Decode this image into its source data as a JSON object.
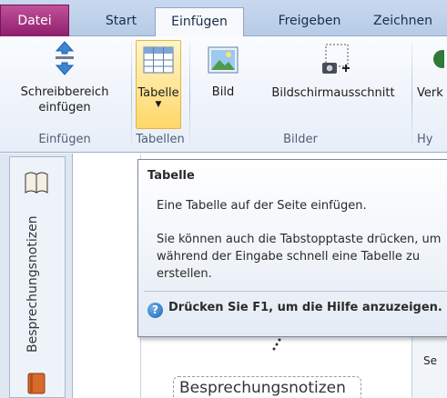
{
  "tabs": [
    {
      "label": "Datei",
      "kind": "file"
    },
    {
      "label": "Start",
      "kind": "normal"
    },
    {
      "label": "Einfügen",
      "kind": "active"
    },
    {
      "label": "Freigeben",
      "kind": "normal"
    },
    {
      "label": "Zeichnen",
      "kind": "normal"
    }
  ],
  "ribbon": {
    "buttons": {
      "schreibbereich": "Schreibbereich einfügen",
      "tabelle": "Tabelle",
      "bild": "Bild",
      "bildschirmausschnitt": "Bildschirmausschnitt",
      "verk": "Verk"
    },
    "groups": {
      "einfuegen": "Einfügen",
      "tabellen": "Tabellen",
      "bilder": "Bilder",
      "hy": "Hy"
    }
  },
  "sidebar": {
    "notebook_label": "Besprechungsnotizen"
  },
  "tooltip": {
    "title": "Tabelle",
    "line1": "Eine Tabelle auf der Seite einfügen.",
    "line2": "Sie können auch die Tabstopptaste drücken, um während der Eingabe schnell eine Tabelle zu erstellen.",
    "help": "Drücken Sie F1, um die Hilfe anzuzeigen."
  },
  "page": {
    "title": "Besprechungsnotizen",
    "right_panel_text": "Se"
  },
  "colors": {
    "file_tab": "#9b2a78",
    "ribbon_bg": "#eef3fa",
    "hover": "#ffd76a",
    "help_icon": "#1f63b5"
  }
}
